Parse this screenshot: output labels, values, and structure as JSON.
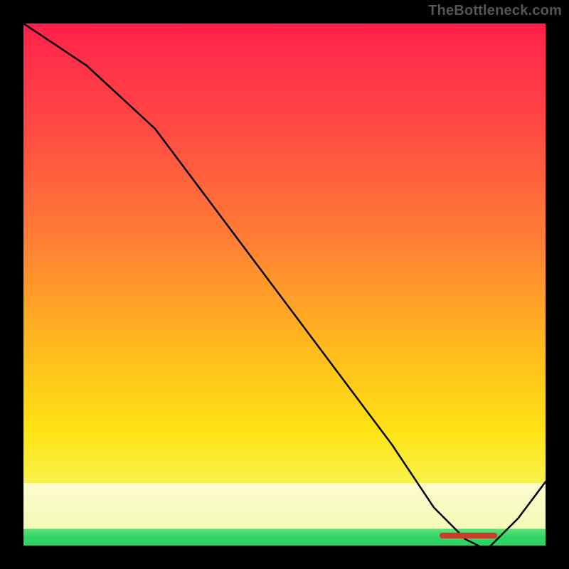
{
  "watermark": "TheBottleneck.com",
  "chart_data": {
    "type": "line",
    "title": "",
    "xlabel": "",
    "ylabel": "",
    "xlim": [
      0,
      100
    ],
    "ylim": [
      0,
      100
    ],
    "grid": false,
    "legend": false,
    "series": [
      {
        "name": "curve",
        "color": "#000000",
        "x": [
          0,
          12,
          25,
          40,
          55,
          70,
          78,
          84,
          88,
          94,
          100
        ],
        "values": [
          100,
          92,
          80,
          60,
          40,
          20,
          8,
          2,
          0,
          6,
          14
        ]
      }
    ],
    "marker": {
      "color": "#cc3a2a",
      "x_start": 79,
      "x_end": 90,
      "y": 1
    },
    "background_gradient": {
      "top": "#ff1f4a",
      "mid": "#ffe313",
      "pale_band": "#fcfccf",
      "bottom_band": "#2fd264"
    }
  }
}
